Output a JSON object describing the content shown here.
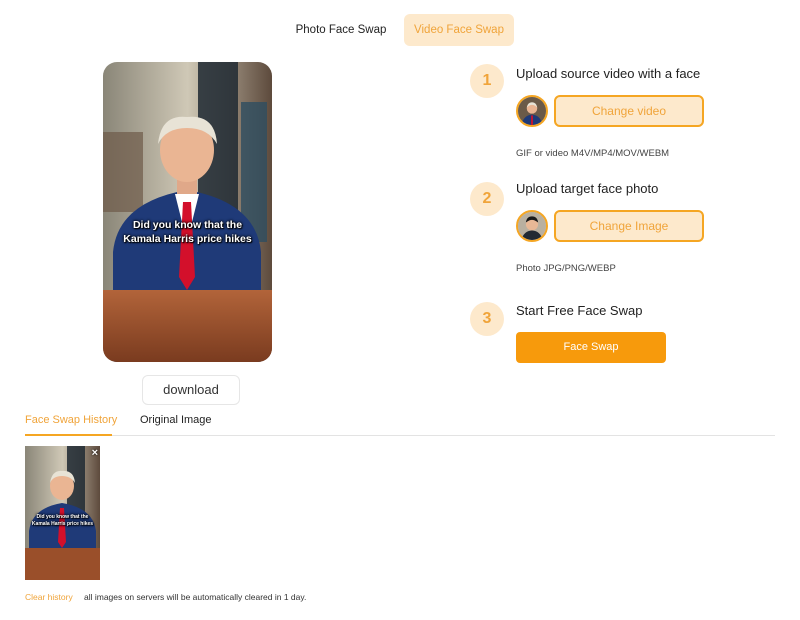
{
  "mode_tabs": {
    "photo_label": "Photo Face Swap",
    "video_label": "Video Face Swap",
    "active": "video"
  },
  "preview": {
    "caption_line1": "Did you know that the",
    "caption_line2": "Kamala Harris price hikes",
    "download_label": "download"
  },
  "steps": [
    {
      "number": "1",
      "title": "Upload source video with a face",
      "button_label": "Change video",
      "hint": "GIF or video M4V/MP4/MOV/WEBM"
    },
    {
      "number": "2",
      "title": "Upload target face photo",
      "button_label": "Change Image",
      "hint": "Photo JPG/PNG/WEBP"
    },
    {
      "number": "3",
      "title": "Start Free Face Swap",
      "button_label": "Face Swap"
    }
  ],
  "history": {
    "tabs": [
      "Face Swap History",
      "Original Image"
    ],
    "active_tab": "Face Swap History",
    "thumbnail_caption_line1": "Did you know that the",
    "thumbnail_caption_line2": "Kamala Harris price hikes",
    "close_symbol": "×",
    "clear_label": "Clear history",
    "clear_note": "all images on servers will be automatically cleared in 1 day."
  },
  "colors": {
    "accent": "#f5a623",
    "accent_light": "#fde9cc",
    "accent_text": "#f0a43a",
    "primary_button": "#f79a0c"
  }
}
